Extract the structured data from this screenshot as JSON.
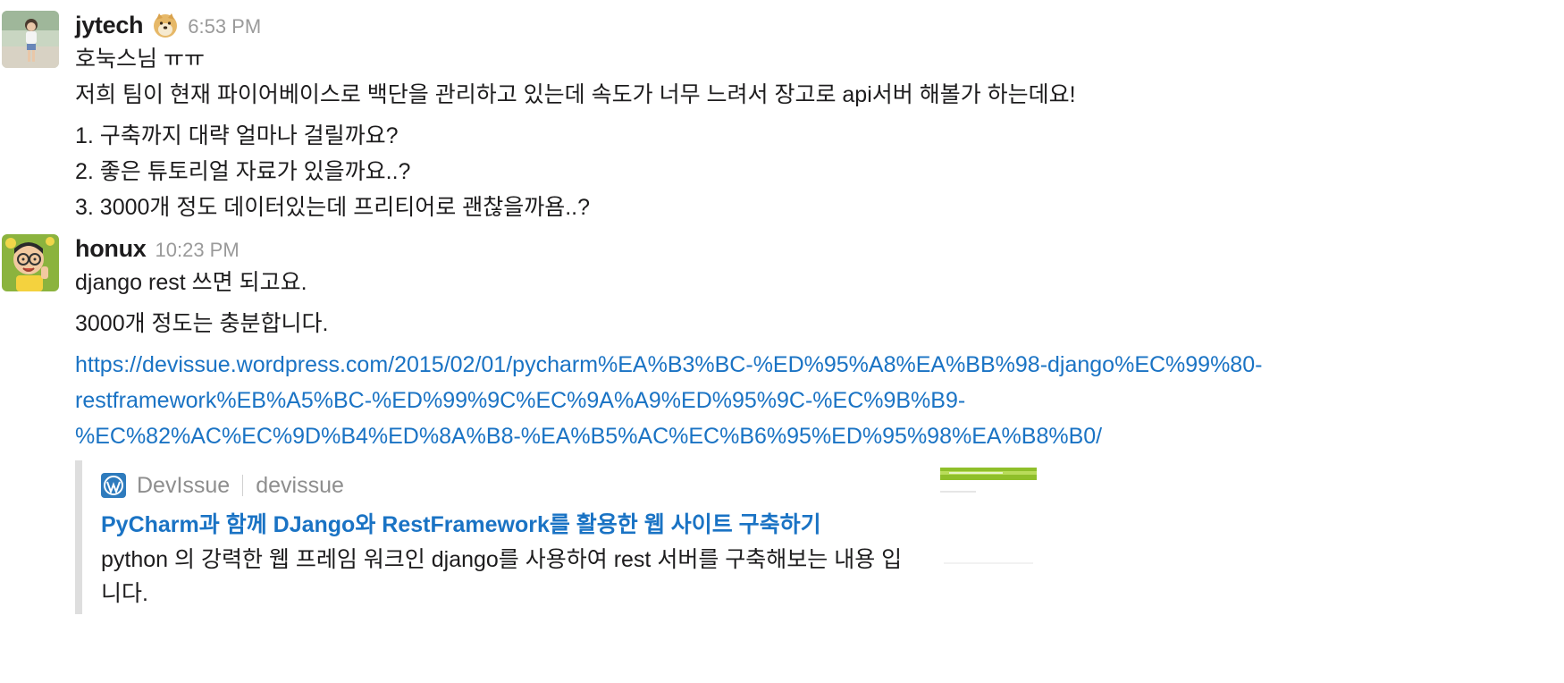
{
  "messages": [
    {
      "username": "jytech",
      "emoji_icon": "doge-emoji-icon",
      "time": "6:53 PM",
      "lines": [
        "호눅스님 ㅠㅠ",
        "저희 팀이 현재 파이어베이스로 백단을 관리하고 있는데 속도가 너무 느려서 장고로 api서버 해볼가 하는데요!",
        "1. 구축까지 대략 얼마나 걸릴까요?",
        "2. 좋은 튜토리얼 자료가 있을까요..?",
        "3. 3000개 정도 데이터있는데 프리티어로 괜찮을까욤..?"
      ]
    },
    {
      "username": "honux",
      "time": "10:23 PM",
      "lines": [
        "django rest 쓰면 되고요.",
        "3000개 정도는 충분합니다."
      ],
      "link_lines": [
        "https://devissue.wordpress.com/2015/02/01/pycharm%EA%B3%BC-%ED%95%A8%EA%BB%98-django%EC%99%80-",
        "restframework%EB%A5%BC-%ED%99%9C%EC%9A%A9%ED%95%9C-%EC%9B%B9-",
        "%EC%82%AC%EC%9D%B4%ED%8A%B8-%EA%B5%AC%EC%B6%95%ED%95%98%EA%B8%B0/"
      ],
      "unfurl": {
        "site_icon": "wordpress-icon",
        "site_name": "DevIssue",
        "site_domain": "devissue",
        "title": "PyCharm과 함께 DJango와 RestFramework를 활용한 웹 사이트 구축하기",
        "description": "python 의 강력한 웹 프레임 워크인 django를 사용하여 rest 서버를 구축해보는 내용 입니다."
      }
    }
  ],
  "colors": {
    "link": "#1a73c4",
    "timestamp": "#9a9a9a",
    "quote_bar": "#dedede"
  }
}
